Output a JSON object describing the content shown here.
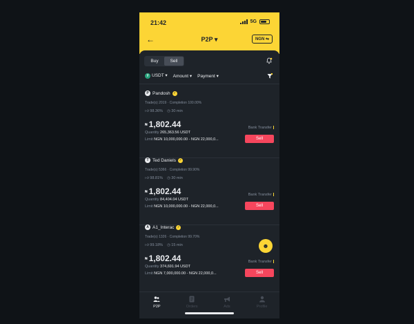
{
  "status_bar": {
    "time": "21:42",
    "network": "5G"
  },
  "header": {
    "title": "P2P",
    "currency": "NGN"
  },
  "segmented": {
    "buy": "Buy",
    "sell": "Sell"
  },
  "filters": {
    "asset": "USDT",
    "amount": "Amount",
    "payment": "Payment"
  },
  "offers": [
    {
      "name": "Pandosh",
      "initial": "P",
      "trades": "Trade(s) 2019 · Completion 100.00%",
      "rating": "98.36%",
      "time": "30 min",
      "price": "1,802.44",
      "currency_symbol": "₦",
      "quantity_label": "Quantity",
      "quantity": "265,363.56 USDT",
      "limit_label": "Limit",
      "limit": "NGN 10,000,000.00 - NGN 22,000,0...",
      "payment": "Bank Transfer",
      "action": "Sell"
    },
    {
      "name": "Ted Daniels",
      "initial": "T",
      "trades": "Trade(s) 5366 · Completion 99.90%",
      "rating": "98.81%",
      "time": "30 min",
      "price": "1,802.44",
      "currency_symbol": "₦",
      "quantity_label": "Quantity",
      "quantity": "84,404.04 USDT",
      "limit_label": "Limit",
      "limit": "NGN 10,000,000.00 - NGN 22,000,0...",
      "payment": "Bank Transfer",
      "action": "Sell"
    },
    {
      "name": "A1_Interac",
      "initial": "A",
      "trades": "Trade(s) 1326 · Completion 99.70%",
      "rating": "99.18%",
      "time": "15 min",
      "price": "1,802.44",
      "currency_symbol": "₦",
      "quantity_label": "Quantity",
      "quantity": "374,691.94 USDT",
      "limit_label": "Limit",
      "limit": "NGN 7,000,000.00 - NGN 22,000,0...",
      "payment": "Bank Transfer",
      "action": "Sell"
    }
  ],
  "nav": [
    {
      "label": "P2P",
      "icon": "users-icon"
    },
    {
      "label": "Orders",
      "icon": "orders-icon"
    },
    {
      "label": "Ads",
      "icon": "megaphone-icon"
    },
    {
      "label": "Profile",
      "icon": "profile-icon"
    }
  ],
  "colors": {
    "brand": "#fcd535",
    "sell": "#f6465d",
    "bg": "#1e2329"
  }
}
